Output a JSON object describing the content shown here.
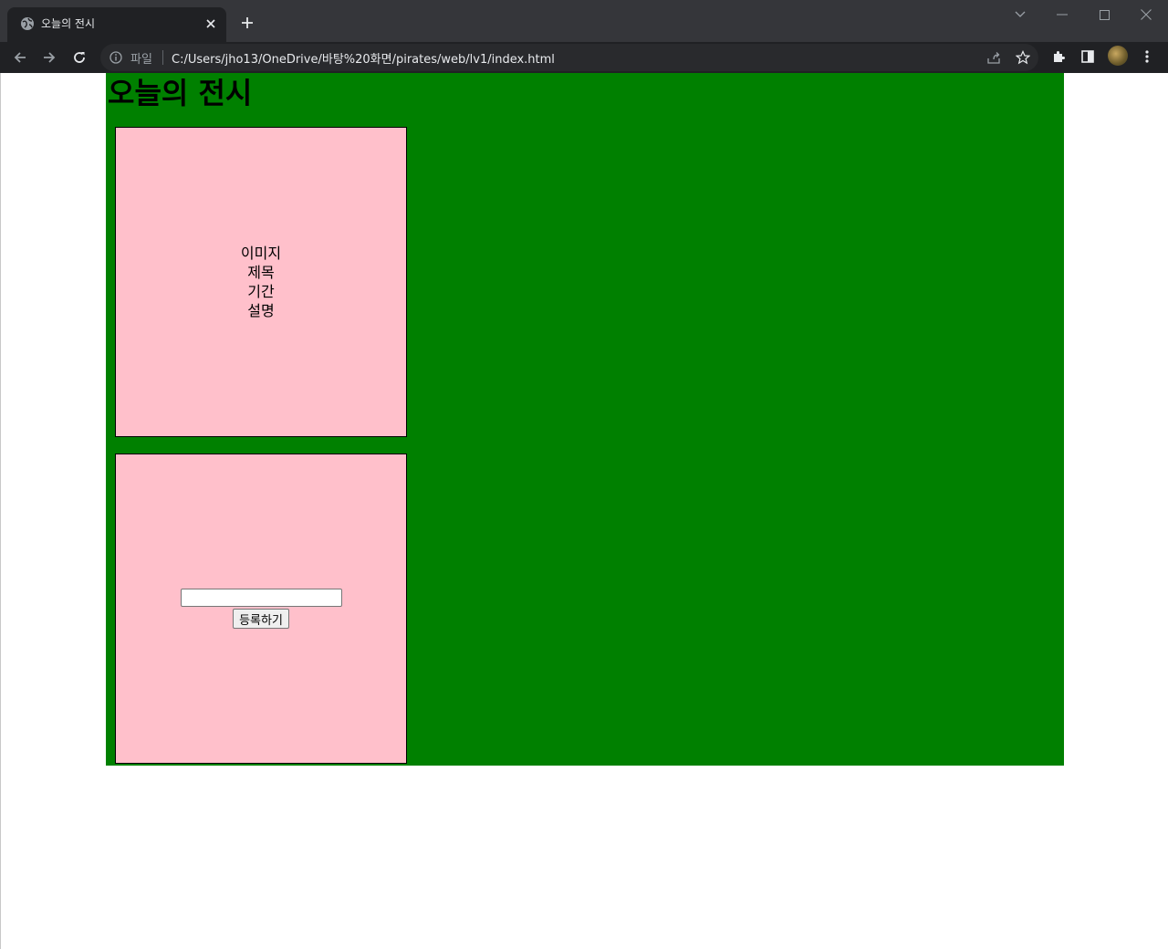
{
  "browser": {
    "tab": {
      "title": "오늘의 전시",
      "favicon": "globe-icon",
      "close_icon": "close-icon"
    },
    "new_tab_icon": "plus-icon",
    "address_bar": {
      "security_label": "파일",
      "url": "C:/Users/jho13/OneDrive/바탕%20화면/pirates/web/lv1/index.html"
    },
    "toolbar_icons": [
      "back-arrow-icon",
      "forward-arrow-icon",
      "reload-icon",
      "info-icon",
      "share-icon",
      "star-icon",
      "extensions-icon",
      "side-panel-icon",
      "profile-avatar",
      "more-menu-icon"
    ],
    "colors": {
      "chrome_dark": "#202124",
      "tabstrip": "#35363a",
      "omnibox": "#292a2d"
    }
  },
  "page": {
    "heading": "오늘의 전시",
    "card1": {
      "lines": [
        "이미지",
        "제목",
        "기간",
        "설명"
      ]
    },
    "card2": {
      "input_value": "",
      "button_label": "등록하기"
    },
    "colors": {
      "container_bg": "#008000",
      "card_bg": "#ffc0cb",
      "card_border": "#000000"
    }
  }
}
